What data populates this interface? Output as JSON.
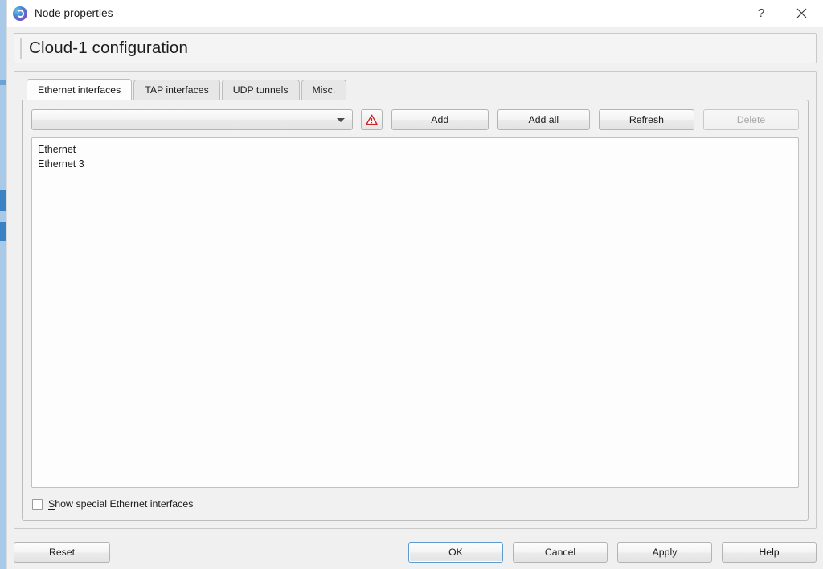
{
  "window": {
    "title": "Node properties",
    "icon": "gns3-logo-icon",
    "help_label": "?",
    "close_label": "close-icon"
  },
  "header": {
    "title": "Cloud-1 configuration"
  },
  "tabs": [
    {
      "label": "Ethernet interfaces",
      "active": true
    },
    {
      "label": "TAP interfaces",
      "active": false
    },
    {
      "label": "UDP tunnels",
      "active": false
    },
    {
      "label": "Misc.",
      "active": false
    }
  ],
  "toolbar": {
    "combo_value": "",
    "combo_placeholder": "",
    "warning_icon": "warning-triangle-icon",
    "buttons": [
      {
        "label": "Add",
        "mnemonic": "A",
        "enabled": true
      },
      {
        "label": "Add all",
        "mnemonic": "A",
        "enabled": true
      },
      {
        "label": "Refresh",
        "mnemonic": "R",
        "enabled": true
      },
      {
        "label": "Delete",
        "mnemonic": "D",
        "enabled": false
      }
    ]
  },
  "interface_list": {
    "items": [
      "Ethernet",
      "Ethernet 3"
    ]
  },
  "options": {
    "show_special": {
      "label": "Show special Ethernet interfaces",
      "mnemonic": "S",
      "checked": false
    }
  },
  "footer": {
    "reset_label": "Reset",
    "ok_label": "OK",
    "cancel_label": "Cancel",
    "apply_label": "Apply",
    "help_label": "Help"
  },
  "colors": {
    "dialog_bg": "#f0f0f0",
    "titlebar_bg": "#ffffff",
    "panel_bg": "#f1f1f1",
    "list_bg": "#fdfdfd",
    "accent_focus": "#5b9bd0",
    "warning_red": "#cc2222",
    "background_app_strip": "#a9c9e8"
  }
}
